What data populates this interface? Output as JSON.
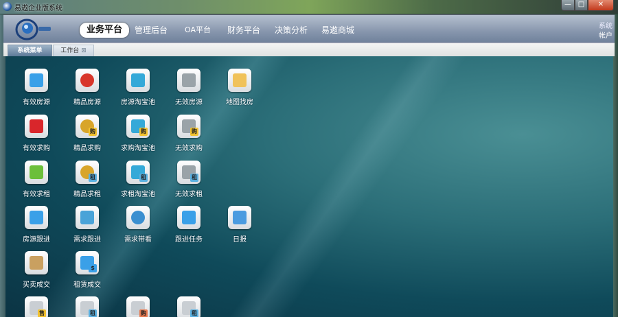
{
  "window": {
    "title": "易遨企业版系统",
    "minimize": "—",
    "maximize": "□",
    "close": "✕"
  },
  "header": {
    "nav": [
      {
        "label": "业务平台",
        "active": true
      },
      {
        "label": "管理后台"
      },
      {
        "label": "OA平台"
      },
      {
        "label": "财务平台"
      },
      {
        "label": "决策分析"
      },
      {
        "label": "易遨商城"
      }
    ],
    "system_link": "系统",
    "account_link": "帐户"
  },
  "tabs": [
    {
      "label": "系统菜单"
    },
    {
      "label": "工作台",
      "close": "⊠"
    }
  ],
  "desktop": {
    "rows": [
      [
        {
          "label": "有效房源",
          "icon": "house-icon",
          "color": "#3aa0e8",
          "badge": ""
        },
        {
          "label": "精品房源",
          "icon": "ribbon-badge-icon",
          "color": "#d8352a",
          "badge": ""
        },
        {
          "label": "房源淘宝池",
          "icon": "basket-icon",
          "color": "#35a9d8",
          "badge": ""
        },
        {
          "label": "无效房源",
          "icon": "trash-icon",
          "color": "#9aa3a8",
          "badge": ""
        },
        {
          "label": "地图找房",
          "icon": "map-pin-icon",
          "color": "#f0c25a",
          "badge": ""
        }
      ],
      [
        {
          "label": "有效求购",
          "icon": "sale-tag-icon",
          "color": "#d9262b",
          "badge": ""
        },
        {
          "label": "精品求购",
          "icon": "ribbon-badge-icon",
          "color": "#d8a52a",
          "badge": "购"
        },
        {
          "label": "求购淘宝池",
          "icon": "basket-icon",
          "color": "#35a9d8",
          "badge": "购"
        },
        {
          "label": "无效求购",
          "icon": "trash-icon",
          "color": "#9aa3a8",
          "badge": "购"
        }
      ],
      [
        {
          "label": "有效求租",
          "icon": "new-tag-icon",
          "color": "#6cbf3a",
          "badge": ""
        },
        {
          "label": "精品求租",
          "icon": "ribbon-badge-icon",
          "color": "#d8a52a",
          "badge": "租"
        },
        {
          "label": "求租淘宝池",
          "icon": "basket-icon",
          "color": "#35a9d8",
          "badge": "租"
        },
        {
          "label": "无效求租",
          "icon": "trash-icon",
          "color": "#9aa3a8",
          "badge": "租"
        }
      ],
      [
        {
          "label": "房源跟进",
          "icon": "folder-bank-icon",
          "color": "#3aa0e8",
          "badge": ""
        },
        {
          "label": "需求跟进",
          "icon": "document-icon",
          "color": "#4aa3d8",
          "badge": ""
        },
        {
          "label": "需求带看",
          "icon": "user-icon",
          "color": "#3b8fd0",
          "badge": ""
        },
        {
          "label": "跟进任务",
          "icon": "folder-bank-icon",
          "color": "#3aa0e8",
          "badge": ""
        },
        {
          "label": "日报",
          "icon": "calendar-icon",
          "color": "#4a9be0",
          "badge": ""
        }
      ],
      [
        {
          "label": "买卖成交",
          "icon": "contract-coins-icon",
          "color": "#c9a060",
          "badge": ""
        },
        {
          "label": "租赁成交",
          "icon": "document-dollar-icon",
          "color": "#3aa0e8",
          "badge": "$"
        }
      ],
      [
        {
          "label": "",
          "icon": "window-sale-icon",
          "color": "#c9ced3",
          "badge": "售"
        },
        {
          "label": "",
          "icon": "window-rent-icon",
          "color": "#c9ced3",
          "badge": "租"
        },
        {
          "label": "",
          "icon": "window-buy-icon",
          "color": "#c9ced3",
          "badge": "购"
        },
        {
          "label": "",
          "icon": "window-rent-icon",
          "color": "#c9ced3",
          "badge": "租"
        }
      ]
    ]
  }
}
